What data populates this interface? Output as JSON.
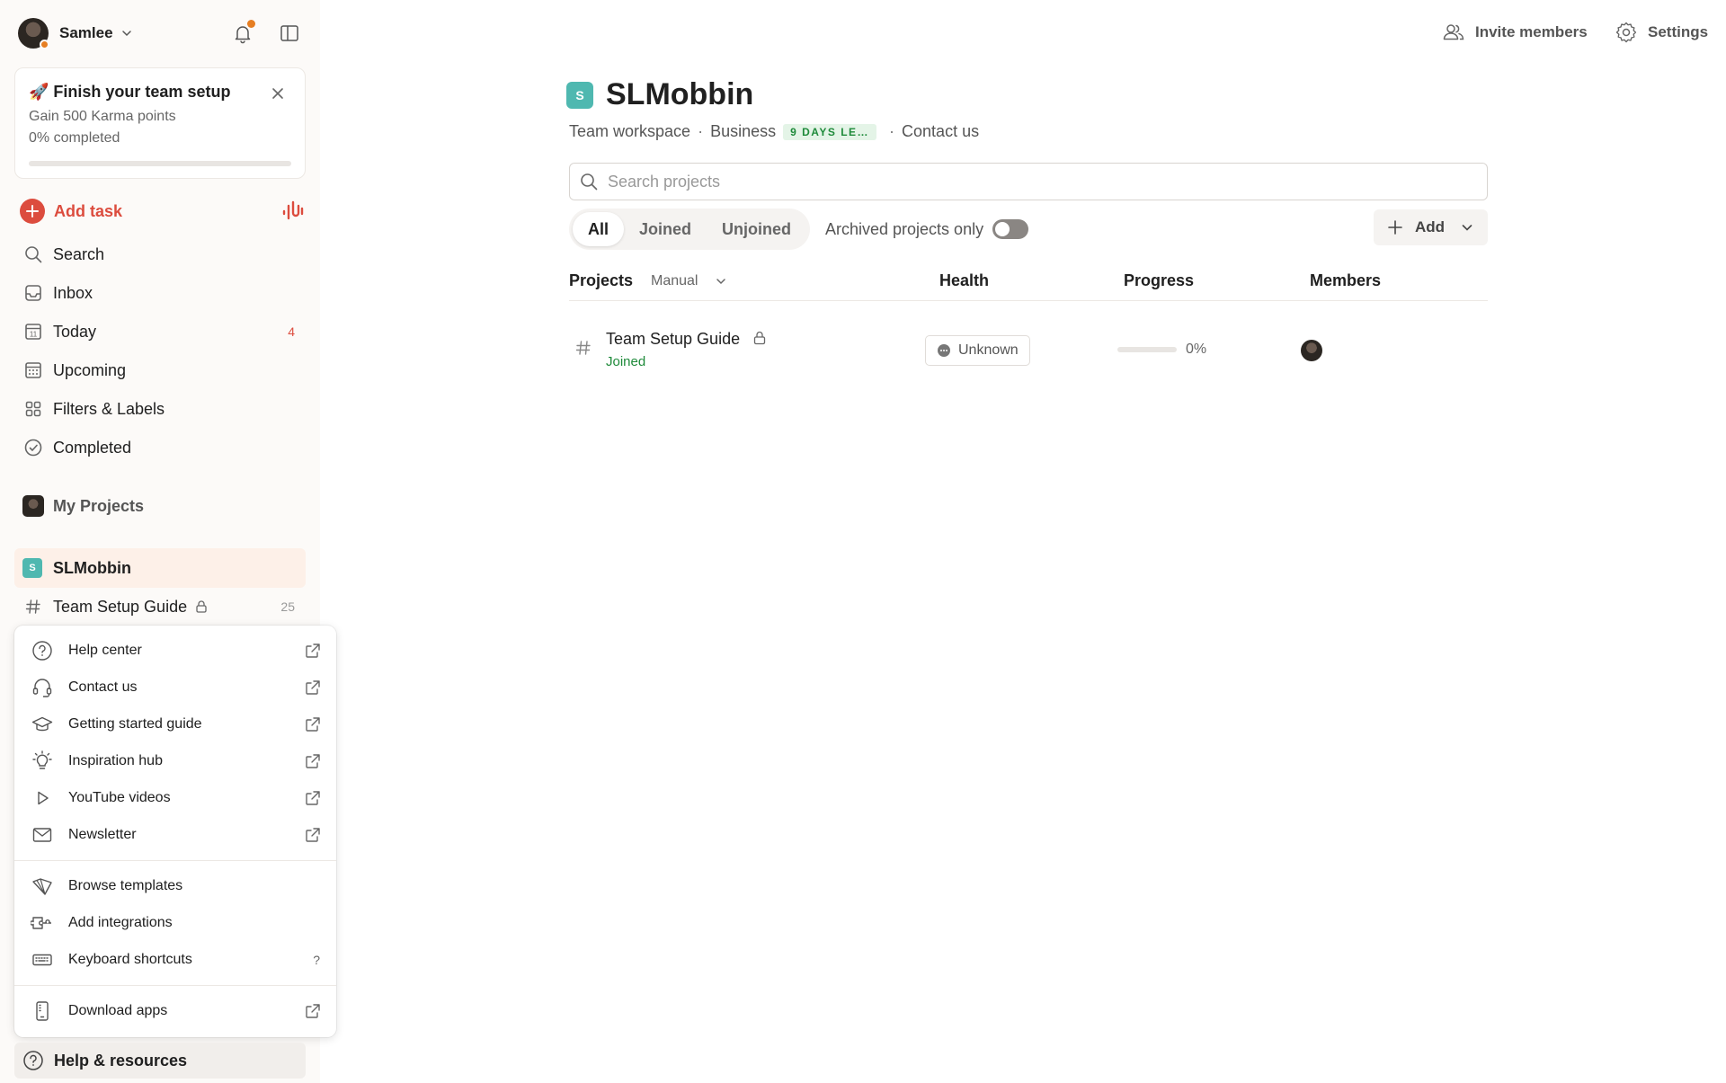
{
  "user": {
    "name": "Samlee"
  },
  "setup_card": {
    "title": "🚀 Finish your team setup",
    "subtitle": "Gain 500 Karma points",
    "progress_label": "0% completed",
    "progress": 0
  },
  "sidebar": {
    "add_task": "Add task",
    "nav": [
      {
        "label": "Search",
        "icon": "search-icon"
      },
      {
        "label": "Inbox",
        "icon": "inbox-icon"
      },
      {
        "label": "Today",
        "icon": "calendar-today-icon",
        "count": "4"
      },
      {
        "label": "Upcoming",
        "icon": "calendar-grid-icon"
      },
      {
        "label": "Filters & Labels",
        "icon": "grid-icon"
      },
      {
        "label": "Completed",
        "icon": "check-circle-icon"
      }
    ],
    "my_projects": "My Projects",
    "workspace": {
      "badge": "S",
      "name": "SLMobbin"
    },
    "project": {
      "name": "Team Setup Guide",
      "count": "25"
    },
    "help_button": "Help & resources"
  },
  "help_menu": {
    "group1": [
      {
        "label": "Help center",
        "icon": "help-circle-icon"
      },
      {
        "label": "Contact us",
        "icon": "headset-icon"
      },
      {
        "label": "Getting started guide",
        "icon": "graduation-cap-icon"
      },
      {
        "label": "Inspiration hub",
        "icon": "lightbulb-icon"
      },
      {
        "label": "YouTube videos",
        "icon": "play-icon"
      },
      {
        "label": "Newsletter",
        "icon": "mail-icon"
      }
    ],
    "group2": [
      {
        "label": "Browse templates",
        "icon": "templates-icon"
      },
      {
        "label": "Add integrations",
        "icon": "integrations-icon"
      },
      {
        "label": "Keyboard shortcuts",
        "icon": "keyboard-icon",
        "shortcut": "?"
      }
    ],
    "group3": [
      {
        "label": "Download apps",
        "icon": "phone-icon"
      }
    ]
  },
  "header": {
    "invite": "Invite members",
    "settings": "Settings",
    "badge": "S",
    "title": "SLMobbin",
    "workspace_type": "Team workspace",
    "plan": "Business",
    "trial": "9 DAYS LE…",
    "contact": "Contact us"
  },
  "search": {
    "placeholder": "Search projects"
  },
  "filters": {
    "tabs": [
      "All",
      "Joined",
      "Unjoined"
    ],
    "active_tab": "All",
    "archived_label": "Archived projects only",
    "archived_on": false,
    "add_label": "Add"
  },
  "table": {
    "columns": {
      "projects": "Projects",
      "sort": "Manual",
      "health": "Health",
      "progress": "Progress",
      "members": "Members"
    },
    "rows": [
      {
        "name": "Team Setup Guide",
        "status": "Joined",
        "health": "Unknown",
        "progress_label": "0%",
        "progress": 0
      }
    ]
  },
  "colors": {
    "accent": "#dc4c3e",
    "workspace": "#4fb8b0",
    "joined": "#1e8a3a",
    "sidebar_bg": "#fcfaf8"
  }
}
